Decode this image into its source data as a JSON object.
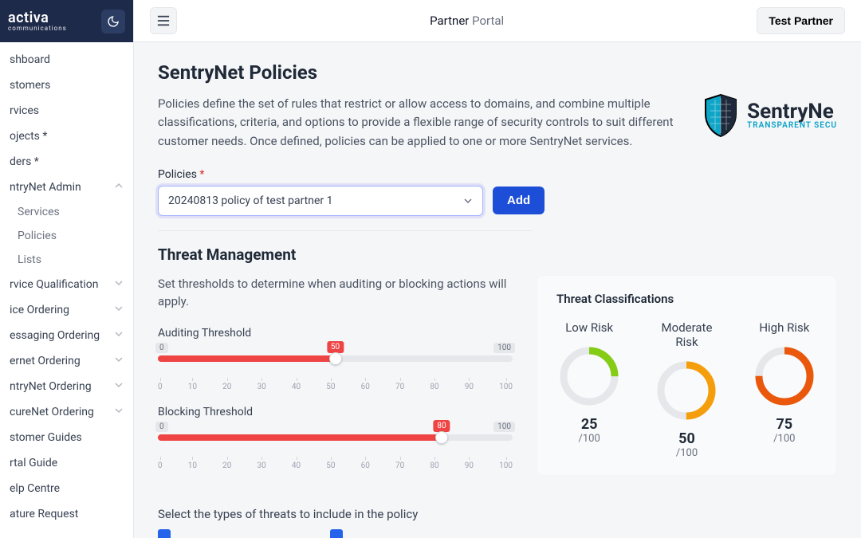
{
  "brand": {
    "name": "activa",
    "sub": "communications"
  },
  "topbar": {
    "title_a": "Partner",
    "title_b": " Portal",
    "test_partner": "Test Partner"
  },
  "sidebar": {
    "items": [
      {
        "label": "shboard",
        "expandable": false
      },
      {
        "label": "stomers",
        "expandable": false
      },
      {
        "label": "rvices",
        "expandable": false
      },
      {
        "label": "ojects *",
        "expandable": false
      },
      {
        "label": "ders *",
        "expandable": false
      },
      {
        "label": "ntryNet Admin",
        "expandable": true,
        "open": true,
        "children": [
          {
            "label": "Services"
          },
          {
            "label": "Policies"
          },
          {
            "label": "Lists"
          }
        ]
      },
      {
        "label": "rvice Qualification",
        "expandable": true
      },
      {
        "label": "ice Ordering",
        "expandable": true
      },
      {
        "label": "essaging Ordering",
        "expandable": true
      },
      {
        "label": "ernet Ordering",
        "expandable": true
      },
      {
        "label": "ntryNet Ordering",
        "expandable": true
      },
      {
        "label": "cureNet Ordering",
        "expandable": true
      },
      {
        "label": "stomer Guides",
        "expandable": false
      },
      {
        "label": "rtal Guide",
        "expandable": false
      },
      {
        "label": "elp Centre",
        "expandable": false
      },
      {
        "label": "ature Request",
        "expandable": false
      }
    ]
  },
  "page": {
    "title": "SentryNet Policies",
    "desc": "Policies define the set of rules that restrict or allow access to domains, and combine multiple classifications, criteria, and options to provide a flexible range of security controls to suit different customer needs. Once defined, policies can be applied to one or more SentryNet services.",
    "logo_top": "SentryNe",
    "logo_sub": "TRANSPARENT SECU"
  },
  "policies_select": {
    "label": "Policies",
    "selected": "20240813 policy of test partner 1",
    "add": "Add"
  },
  "threat": {
    "title": "Threat Management",
    "desc": "Set thresholds to determine when auditing or blocking actions will apply.",
    "auditing_label": "Auditing Threshold",
    "blocking_label": "Blocking Threshold",
    "auditing_value": 50,
    "blocking_value": 80,
    "min": 0,
    "max": 100,
    "ticks": [
      "0",
      "10",
      "20",
      "30",
      "40",
      "50",
      "60",
      "70",
      "80",
      "90",
      "100"
    ]
  },
  "classifications": {
    "title": "Threat Classifications",
    "gauges": [
      {
        "label": "Low Risk",
        "value": 25,
        "max": 100,
        "color": "#84cc16"
      },
      {
        "label": "Moderate Risk",
        "value": 50,
        "max": 100,
        "color": "#f59e0b"
      },
      {
        "label": "High Risk",
        "value": 75,
        "max": 100,
        "color": "#ea580c"
      }
    ]
  },
  "include_text": "Select the types of threats to include in the policy"
}
